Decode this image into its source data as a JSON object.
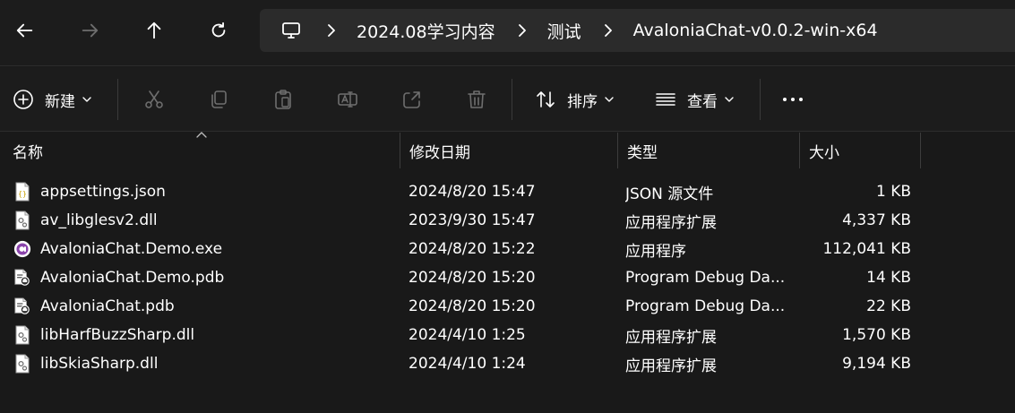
{
  "nav": {
    "back_icon": "back-arrow-icon",
    "forward_icon": "forward-arrow-icon",
    "up_icon": "up-arrow-icon",
    "refresh_icon": "refresh-icon"
  },
  "address": {
    "root_icon": "this-pc-icon",
    "crumbs": [
      "2024.08学习内容",
      "测试",
      "AvaloniaChat-v0.0.2-win-x64"
    ]
  },
  "toolbar": {
    "new_label": "新建",
    "sort_label": "排序",
    "view_label": "查看",
    "more_icon": "more-options-icon"
  },
  "columns": {
    "name": "名称",
    "date": "修改日期",
    "type": "类型",
    "size": "大小"
  },
  "files": [
    {
      "name": "appsettings.json",
      "date": "2024/8/20 15:47",
      "type": "JSON 源文件",
      "size": "1 KB",
      "icon": "json-file-icon"
    },
    {
      "name": "av_libglesv2.dll",
      "date": "2023/9/30 15:47",
      "type": "应用程序扩展",
      "size": "4,337 KB",
      "icon": "dll-file-icon"
    },
    {
      "name": "AvaloniaChat.Demo.exe",
      "date": "2024/8/20 15:22",
      "type": "应用程序",
      "size": "112,041 KB",
      "icon": "avalonia-app-icon"
    },
    {
      "name": "AvaloniaChat.Demo.pdb",
      "date": "2024/8/20 15:20",
      "type": "Program Debug Da...",
      "size": "14 KB",
      "icon": "pdb-file-icon"
    },
    {
      "name": "AvaloniaChat.pdb",
      "date": "2024/8/20 15:20",
      "type": "Program Debug Da...",
      "size": "22 KB",
      "icon": "pdb-file-icon"
    },
    {
      "name": "libHarfBuzzSharp.dll",
      "date": "2024/4/10 1:25",
      "type": "应用程序扩展",
      "size": "1,570 KB",
      "icon": "dll-file-icon"
    },
    {
      "name": "libSkiaSharp.dll",
      "date": "2024/4/10 1:24",
      "type": "应用程序扩展",
      "size": "9,194 KB",
      "icon": "dll-file-icon"
    }
  ],
  "colors": {
    "background": "#191919",
    "toolbar_bg": "#1c1c1c",
    "address_bg": "#2b2b2b",
    "accent_blue": "#4cc2ff",
    "avalonia_purple": "#8b44ac"
  }
}
